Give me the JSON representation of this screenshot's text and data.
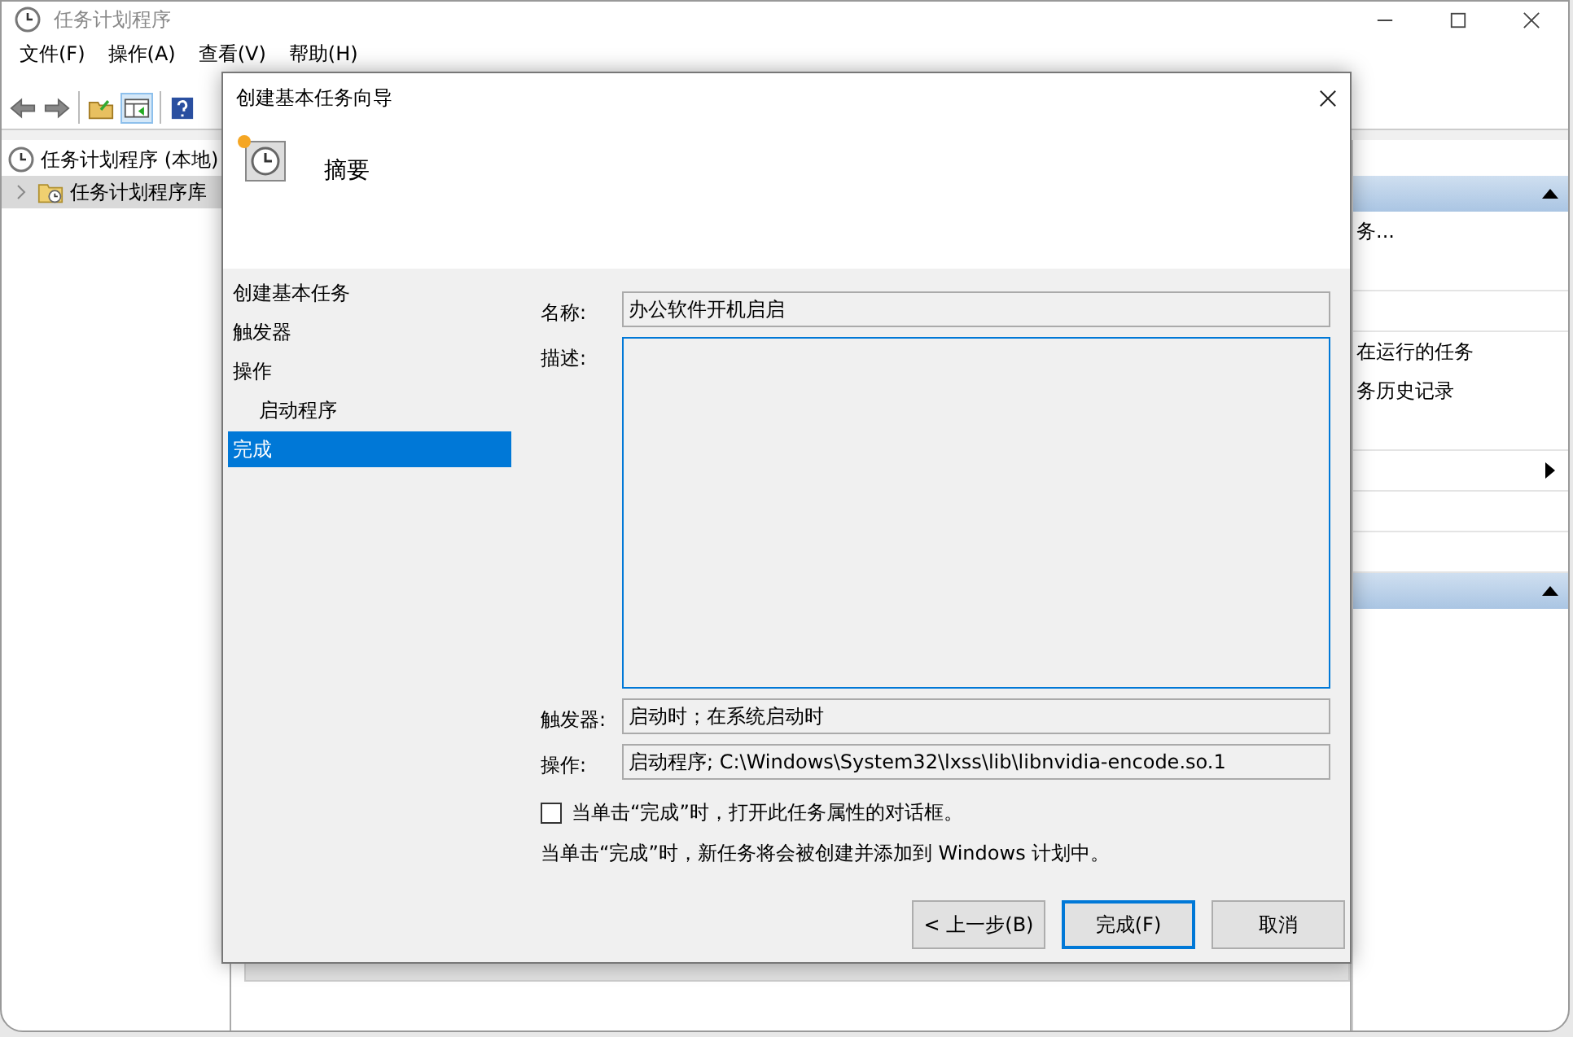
{
  "window": {
    "title": "任务计划程序",
    "menu": [
      "文件(F)",
      "操作(A)",
      "查看(V)",
      "帮助(H)"
    ]
  },
  "tree": [
    {
      "label": "任务计划程序 (本地)",
      "selected": false,
      "children": [
        {
          "label": "任务计划程序库",
          "selected": true,
          "expanded": false
        }
      ]
    }
  ],
  "actions": [
    {
      "kind": "header"
    },
    {
      "kind": "item",
      "label": "务..."
    },
    {
      "kind": "blank"
    },
    {
      "kind": "blank"
    },
    {
      "kind": "item",
      "label": "在运行的任务"
    },
    {
      "kind": "item",
      "label": "务历史记录"
    },
    {
      "kind": "blank"
    },
    {
      "kind": "submenu"
    },
    {
      "kind": "blank"
    },
    {
      "kind": "blank"
    },
    {
      "kind": "header"
    }
  ],
  "dialog": {
    "title": "创建基本任务向导",
    "heading": "摘要",
    "steps": [
      {
        "label": "创建基本任务",
        "selected": false
      },
      {
        "label": "触发器",
        "selected": false
      },
      {
        "label": "操作",
        "selected": false,
        "children": [
          {
            "label": "启动程序",
            "selected": false
          }
        ]
      },
      {
        "label": "完成",
        "selected": true
      }
    ],
    "fields": [
      {
        "kind": "line",
        "label": "名称:",
        "value": "办公软件开机启启"
      },
      {
        "kind": "area",
        "label": "描述:"
      },
      {
        "kind": "line",
        "label": "触发器:",
        "value": "启动时；在系统启动时"
      },
      {
        "kind": "line",
        "label": "操作:",
        "value": "启动程序; C:\\Windows\\System32\\lxss\\lib\\libnvidia-encode.so.1"
      }
    ],
    "checkbox": {
      "label": "当单击“完成”时，打开此任务属性的对话框。",
      "checked": false
    },
    "note": "当单击“完成”时，新任务将会被创建并添加到 Windows 计划中。",
    "buttons": [
      {
        "label": "< 上一步(B)",
        "kind": "normal"
      },
      {
        "label": "完成(F)",
        "kind": "default"
      },
      {
        "label": "取消",
        "kind": "normal"
      }
    ]
  }
}
